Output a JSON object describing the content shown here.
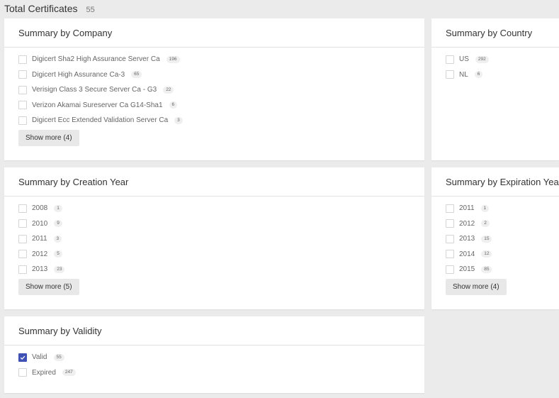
{
  "header": {
    "title": "Total Certificates",
    "count": "55"
  },
  "colors": {
    "check_accent": "#3f51b5",
    "background": "#ebebeb"
  },
  "company": {
    "title": "Summary by Company",
    "items": [
      {
        "label": "Digicert Sha2 High Assurance Server Ca",
        "count": "196",
        "checked": false
      },
      {
        "label": "Digicert High Assurance Ca-3",
        "count": "65",
        "checked": false
      },
      {
        "label": "Verisign Class 3 Secure Server Ca - G3",
        "count": "22",
        "checked": false
      },
      {
        "label": "Verizon Akamai Sureserver Ca G14-Sha1",
        "count": "6",
        "checked": false
      },
      {
        "label": "Digicert Ecc Extended Validation Server Ca",
        "count": "3",
        "checked": false
      }
    ],
    "show_more": "Show more (4)"
  },
  "country": {
    "title": "Summary by Country",
    "items": [
      {
        "label": "US",
        "count": "292",
        "checked": false
      },
      {
        "label": "NL",
        "count": "6",
        "checked": false
      }
    ]
  },
  "creation_year": {
    "title": "Summary by Creation Year",
    "items": [
      {
        "label": "2008",
        "count": "1",
        "checked": false
      },
      {
        "label": "2010",
        "count": "9",
        "checked": false
      },
      {
        "label": "2011",
        "count": "3",
        "checked": false
      },
      {
        "label": "2012",
        "count": "5",
        "checked": false
      },
      {
        "label": "2013",
        "count": "23",
        "checked": false
      }
    ],
    "show_more": "Show more (5)"
  },
  "expiration_year": {
    "title": "Summary by Expiration Year",
    "items": [
      {
        "label": "2011",
        "count": "1",
        "checked": false
      },
      {
        "label": "2012",
        "count": "2",
        "checked": false
      },
      {
        "label": "2013",
        "count": "15",
        "checked": false
      },
      {
        "label": "2014",
        "count": "12",
        "checked": false
      },
      {
        "label": "2015",
        "count": "85",
        "checked": false
      }
    ],
    "show_more": "Show more (4)"
  },
  "validity": {
    "title": "Summary by Validity",
    "items": [
      {
        "label": "Valid",
        "count": "55",
        "checked": true
      },
      {
        "label": "Expired",
        "count": "247",
        "checked": false
      }
    ]
  }
}
